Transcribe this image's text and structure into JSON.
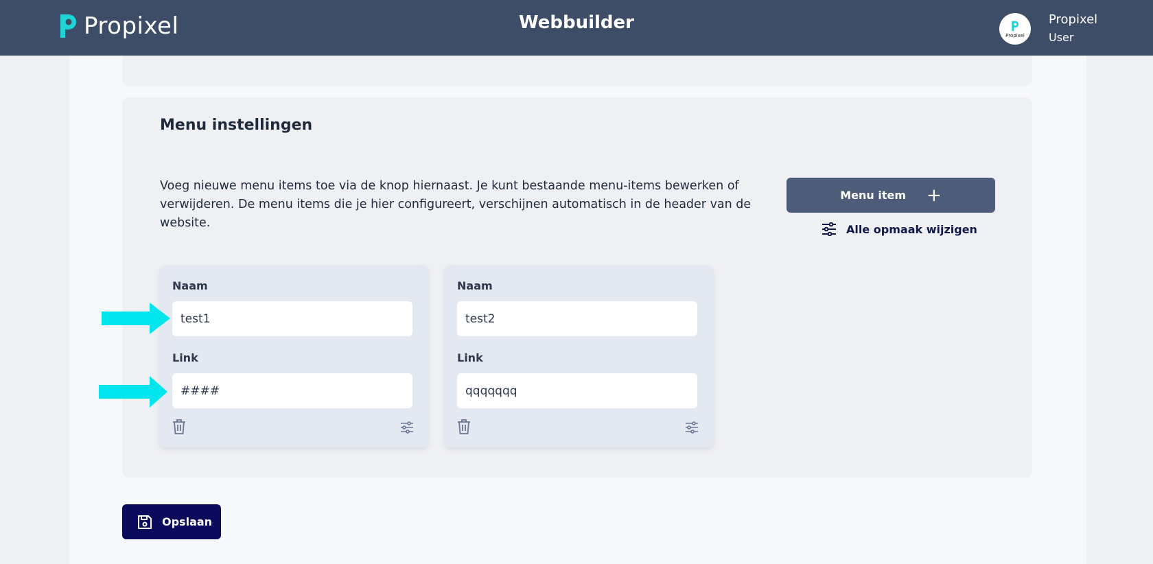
{
  "header": {
    "logo_text": "Propixel",
    "title": "Webbuilder",
    "user_name": "Propixel",
    "user_role": "User",
    "avatar_text": "Propixel"
  },
  "menu_settings": {
    "title": "Menu instellingen",
    "description": "Voeg nieuwe menu items toe via de knop hiernaast. Je kunt bestaande menu-items bewerken of verwijderen. De menu items die je hier configureert, verschijnen automatisch in de header van de website.",
    "add_button_label": "Menu item",
    "add_button_icon": "plus-icon",
    "style_link_label": "Alle opmaak wijzigen",
    "style_link_icon": "sliders-icon"
  },
  "menu_items": [
    {
      "name_label": "Naam",
      "name_value": "test1",
      "link_label": "Link",
      "link_value": "####"
    },
    {
      "name_label": "Naam",
      "name_value": "test2",
      "link_label": "Link",
      "link_value": "qqqqqqq"
    }
  ],
  "save_button_label": "Opslaan",
  "colors": {
    "header_bg": "#3e4d67",
    "accent_cyan": "#00e5ee",
    "primary_button": "#4d5c78",
    "save_button": "#0b0a5c"
  }
}
